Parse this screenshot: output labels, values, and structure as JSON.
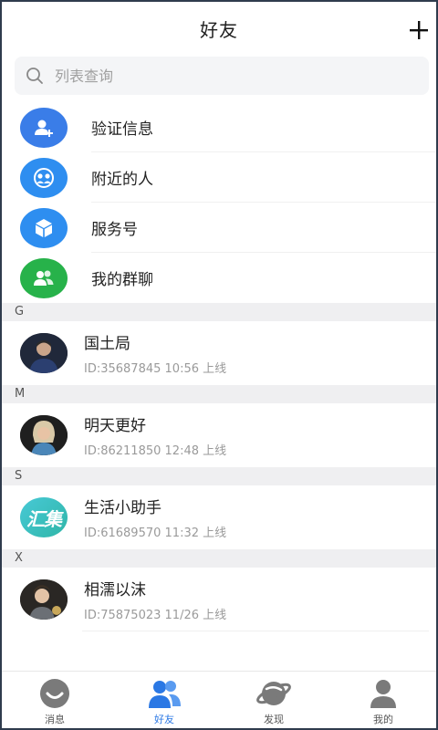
{
  "header": {
    "title": "好友",
    "add_icon": "plus-icon"
  },
  "search": {
    "placeholder": "列表查询",
    "value": ""
  },
  "features": [
    {
      "label": "验证信息",
      "icon": "add-user-icon",
      "color": "#3a7de8"
    },
    {
      "label": "附近的人",
      "icon": "nearby-people-icon",
      "color": "#2e8ef0"
    },
    {
      "label": "服务号",
      "icon": "cube-icon",
      "color": "#2e8ef0"
    },
    {
      "label": "我的群聊",
      "icon": "group-chat-icon",
      "color": "#27b24a"
    }
  ],
  "sections": [
    {
      "letter": "G",
      "contacts": [
        {
          "name": "国土局",
          "meta": "ID:35687845  10:56 上线"
        }
      ]
    },
    {
      "letter": "M",
      "contacts": [
        {
          "name": "明天更好",
          "meta": "ID:86211850  12:48 上线"
        }
      ]
    },
    {
      "letter": "S",
      "contacts": [
        {
          "name": "生活小助手",
          "meta": "ID:61689570  11:32 上线",
          "avatar_text": "汇集"
        }
      ]
    },
    {
      "letter": "X",
      "contacts": [
        {
          "name": "相濡以沫",
          "meta": "ID:75875023  11/26 上线"
        }
      ]
    }
  ],
  "nav": [
    {
      "label": "消息",
      "icon": "message-icon",
      "active": false
    },
    {
      "label": "好友",
      "icon": "friends-icon",
      "active": true
    },
    {
      "label": "发现",
      "icon": "planet-icon",
      "active": false
    },
    {
      "label": "我的",
      "icon": "profile-icon",
      "active": false
    }
  ],
  "colors": {
    "accent": "#2b78e4",
    "green": "#27b24a",
    "section_bg": "#efeff1"
  }
}
